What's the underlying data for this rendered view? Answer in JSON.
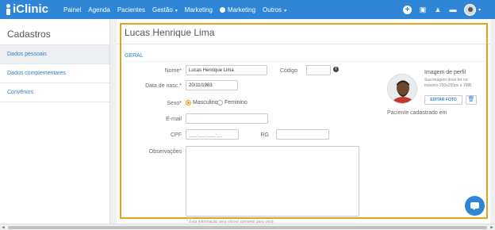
{
  "topbar": {
    "logo": "iClinic",
    "nav": [
      {
        "label": "Painel"
      },
      {
        "label": "Agenda"
      },
      {
        "label": "Pacientes"
      },
      {
        "label": "Gestão",
        "dropdown": true
      },
      {
        "label": "Marketing"
      },
      {
        "label": "Marketing",
        "icon": "marketing-icon"
      },
      {
        "label": "Outros",
        "dropdown": true
      }
    ],
    "icons": [
      "add-icon",
      "gift-icon",
      "bell-icon",
      "chat-icon",
      "user-avatar"
    ],
    "color": "#2f86d6"
  },
  "sidebar": {
    "title": "Cadastros",
    "items": [
      {
        "label": "Dados pessoais",
        "active": true
      },
      {
        "label": "Dados complementares",
        "active": false
      },
      {
        "label": "Convênios",
        "active": false
      }
    ]
  },
  "patient": {
    "name": "Lucas Henrique Lima",
    "section": "GERAL",
    "fields": {
      "name_label": "Nome*",
      "name_value": "Lucas Henrique Lima",
      "code_label": "Código",
      "code_value": "",
      "birth_label": "Data de nasc.*",
      "birth_value": "20/11/1983",
      "sex_label": "Sexo*",
      "sex_options": [
        "Masculino",
        "Feminino"
      ],
      "sex_selected": "Masculino",
      "email_label": "E-mail",
      "email_value": "",
      "cpf_label": "CPF",
      "cpf_placeholder": "___.___.___-__",
      "rg_label": "RG",
      "rg_value": "",
      "obs_label": "Observações"
    },
    "profile_image": {
      "title": "Imagem de perfil",
      "note": "Sua imagem deve ter no máximo 250x250px e 1MB.",
      "edit_button": "EDITAR FOTO"
    },
    "registered_text": "Paciente cadastrado em",
    "footnote": "* Esta informação será visível somente para você."
  },
  "colors": {
    "accent": "#2f86d6",
    "highlight": "#e6a21a",
    "radio_selected": "#f39c12"
  }
}
